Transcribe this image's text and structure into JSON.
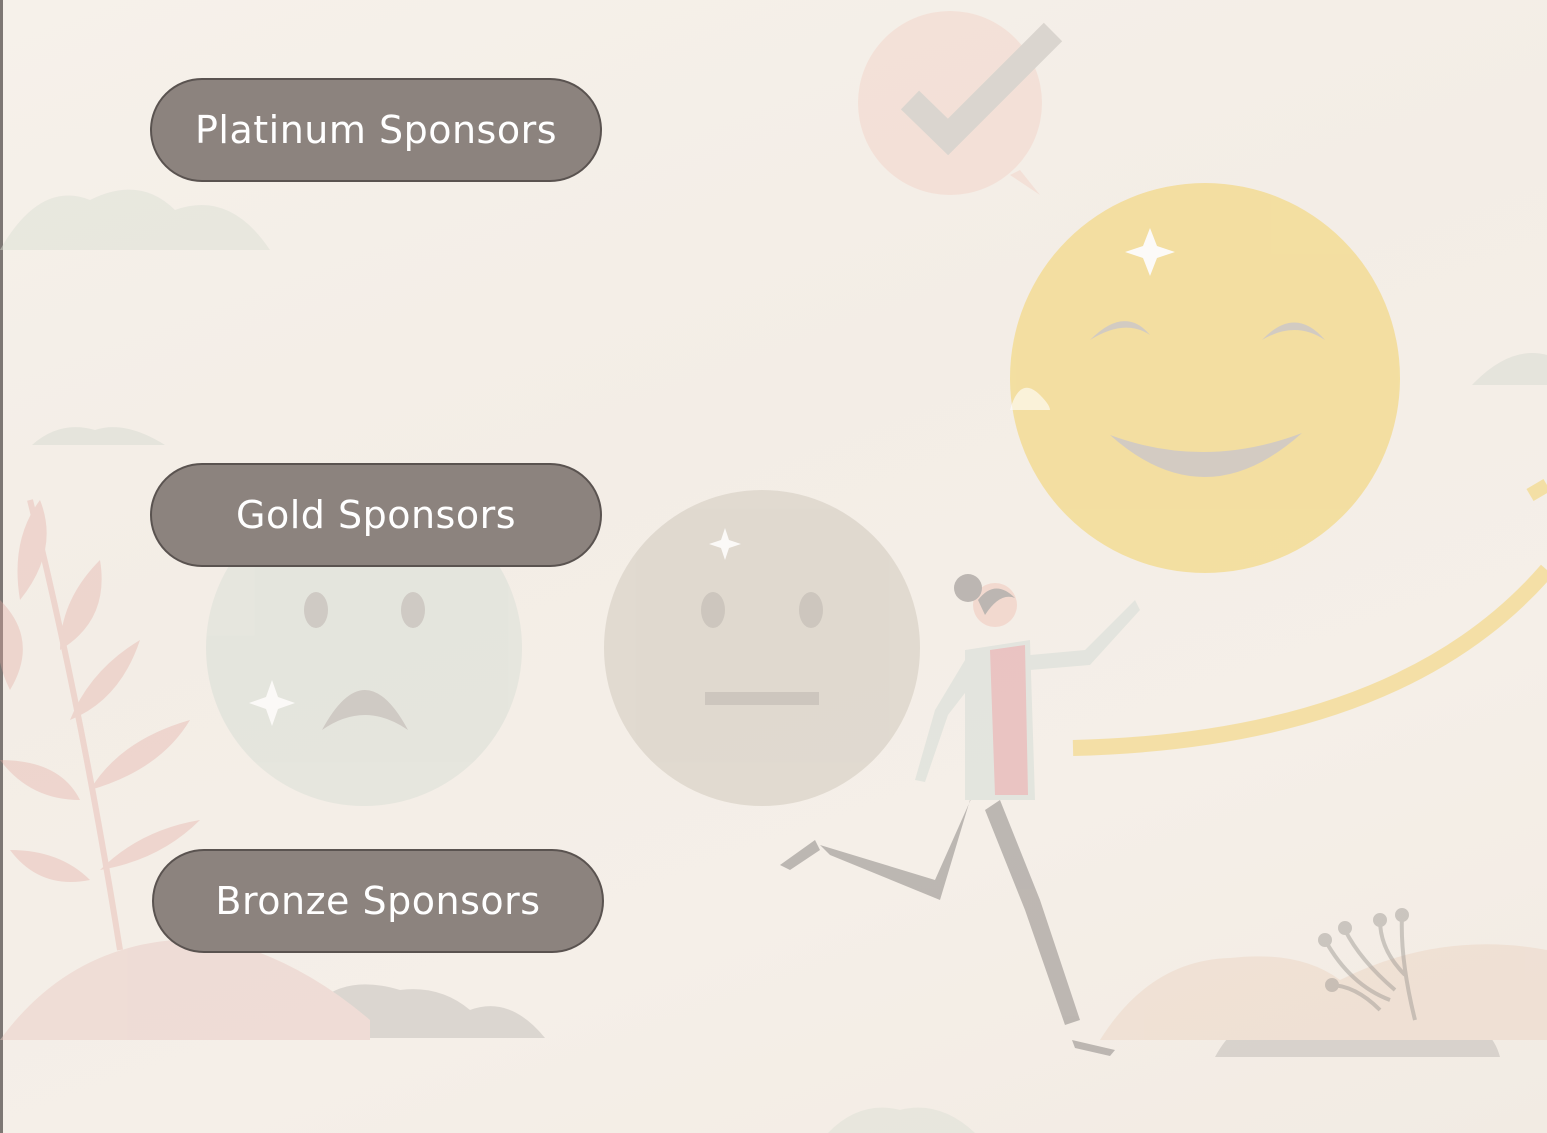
{
  "buttons": {
    "platinum_label": "Platinum Sponsors",
    "gold_label": "Gold Sponsors",
    "bronze_label": "Bronze Sponsors"
  },
  "colors": {
    "button_fill": "#8c837e",
    "button_border": "#5a5350",
    "button_text": "#ffffff",
    "background": "#f5efe8",
    "happy_face": "#f5dc8c",
    "neutral_face": "#ddd6cc",
    "sad_face": "#dfe3dc"
  },
  "illustration": {
    "icons": [
      "checkmark-speech-bubble-icon",
      "happy-face-icon",
      "neutral-face-icon",
      "sad-face-icon",
      "running-woman-figure"
    ]
  }
}
